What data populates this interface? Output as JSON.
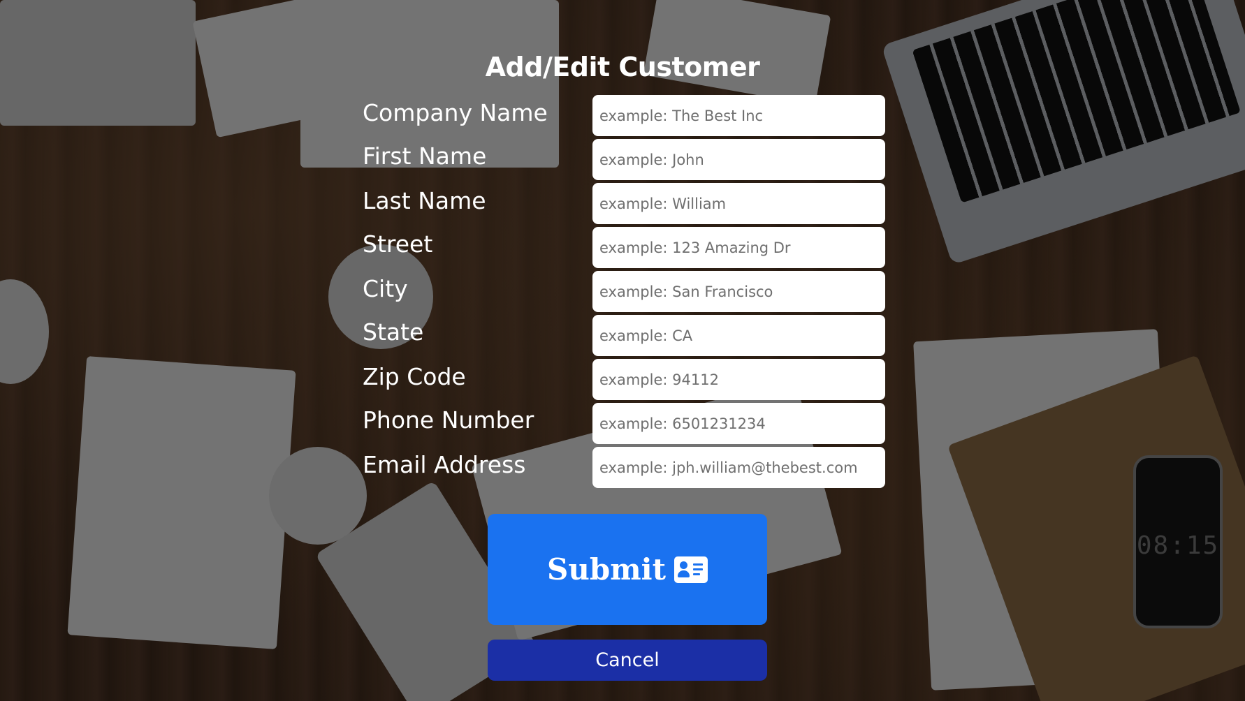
{
  "form": {
    "title": "Add/Edit Customer",
    "fields": [
      {
        "label": "Company Name",
        "placeholder": "example: The Best Inc",
        "value": ""
      },
      {
        "label": "First Name",
        "placeholder": "example: John",
        "value": ""
      },
      {
        "label": "Last Name",
        "placeholder": "example: William",
        "value": ""
      },
      {
        "label": "Street",
        "placeholder": "example: 123 Amazing Dr",
        "value": ""
      },
      {
        "label": "City",
        "placeholder": "example: San Francisco",
        "value": ""
      },
      {
        "label": "State",
        "placeholder": "example: CA",
        "value": ""
      },
      {
        "label": "Zip Code",
        "placeholder": "example: 94112",
        "value": ""
      },
      {
        "label": "Phone Number",
        "placeholder": "example: 6501231234",
        "value": ""
      },
      {
        "label": "Email Address",
        "placeholder": "example: jph.william@thebest.com",
        "value": ""
      }
    ],
    "submit_label": "Submit",
    "submit_icon": "contact-card-icon",
    "cancel_label": "Cancel"
  },
  "background": {
    "phone_time": "08:15"
  },
  "colors": {
    "submit": "#1a72f0",
    "cancel": "#1b2fa6",
    "overlay": "rgba(0,0,0,0.5)"
  }
}
